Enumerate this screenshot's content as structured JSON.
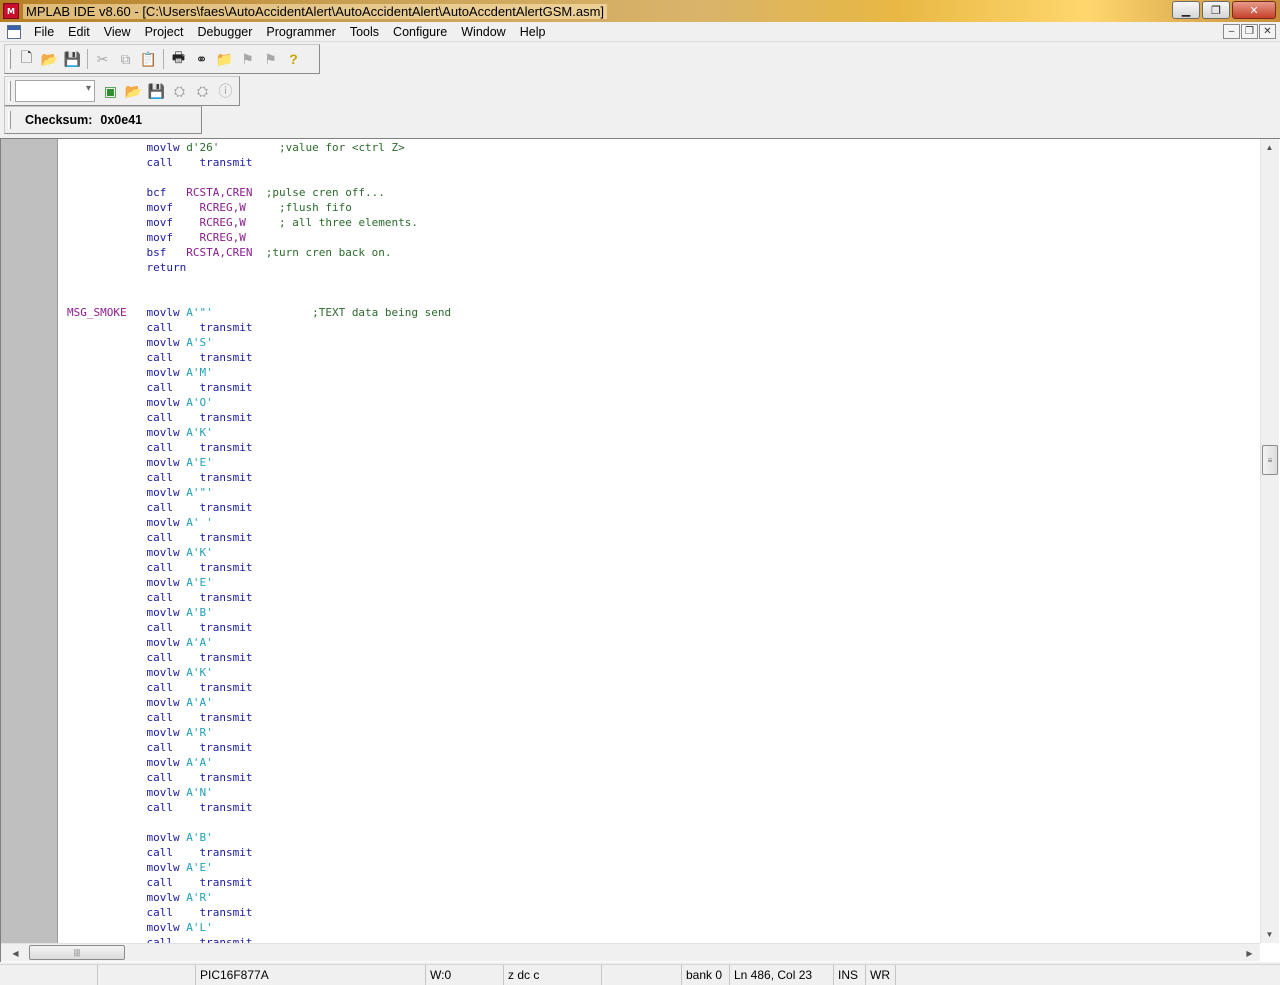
{
  "window": {
    "title": "MPLAB IDE v8.60 - [C:\\Users\\faes\\AutoAccidentAlert\\AutoAccidentAlert\\AutoAccdentAlertGSM.asm]",
    "app_icon_text": "M"
  },
  "menu": [
    "File",
    "Edit",
    "View",
    "Project",
    "Debugger",
    "Programmer",
    "Tools",
    "Configure",
    "Window",
    "Help"
  ],
  "toolbar": {
    "checksum_label": "Checksum:",
    "checksum_value": "0x0e41",
    "combo_value": ""
  },
  "status": {
    "s0": "",
    "device": "PIC16F877A",
    "s2": "",
    "w": "W:0",
    "flags": "z dc c",
    "s5": "",
    "bank": "bank 0",
    "position": "Ln 486, Col 23",
    "ins": "INS",
    "wr": "WR"
  },
  "code_lines": [
    {
      "label": "",
      "op": "movlw",
      "arg": "d'26'",
      "arg_kind": "cm",
      "comment": ";value for <ctrl Z>",
      "pad": "         "
    },
    {
      "label": "",
      "op": "call",
      "arg": "transmit",
      "arg_kind": "txt",
      "comment": "",
      "pad": ""
    },
    {
      "label": "",
      "op": "",
      "arg": "",
      "arg_kind": "txt",
      "comment": "",
      "pad": ""
    },
    {
      "label": "",
      "op": "bcf",
      "arg": "RCSTA,CREN",
      "arg_kind": "lbl",
      "comment": ";pulse cren off...",
      "pad": "  "
    },
    {
      "label": "",
      "op": "movf",
      "arg": "RCREG,W",
      "arg_kind": "lbl",
      "comment": ";flush fifo",
      "pad": "     "
    },
    {
      "label": "",
      "op": "movf",
      "arg": "RCREG,W",
      "arg_kind": "lbl",
      "comment": "; all three elements.",
      "pad": "     "
    },
    {
      "label": "",
      "op": "movf",
      "arg": "RCREG,W",
      "arg_kind": "lbl",
      "comment": "",
      "pad": ""
    },
    {
      "label": "",
      "op": "bsf",
      "arg": "RCSTA,CREN",
      "arg_kind": "lbl",
      "comment": ";turn cren back on.",
      "pad": "  "
    },
    {
      "label": "",
      "op": "return",
      "arg": "",
      "arg_kind": "txt",
      "comment": "",
      "pad": ""
    },
    {
      "label": "",
      "op": "",
      "arg": "",
      "arg_kind": "txt",
      "comment": "",
      "pad": ""
    },
    {
      "label": "",
      "op": "",
      "arg": "",
      "arg_kind": "txt",
      "comment": "",
      "pad": ""
    },
    {
      "label": "MSG_SMOKE",
      "op": "movlw",
      "arg": "A'\"'",
      "arg_kind": "str",
      "comment": ";TEXT data being send",
      "pad": "               "
    },
    {
      "label": "",
      "op": "call",
      "arg": "transmit",
      "arg_kind": "txt",
      "comment": "",
      "pad": ""
    },
    {
      "label": "",
      "op": "movlw",
      "arg": "A'S'",
      "arg_kind": "str",
      "comment": "",
      "pad": ""
    },
    {
      "label": "",
      "op": "call",
      "arg": "transmit",
      "arg_kind": "txt",
      "comment": "",
      "pad": ""
    },
    {
      "label": "",
      "op": "movlw",
      "arg": "A'M'",
      "arg_kind": "str",
      "comment": "",
      "pad": ""
    },
    {
      "label": "",
      "op": "call",
      "arg": "transmit",
      "arg_kind": "txt",
      "comment": "",
      "pad": ""
    },
    {
      "label": "",
      "op": "movlw",
      "arg": "A'O'",
      "arg_kind": "str",
      "comment": "",
      "pad": ""
    },
    {
      "label": "",
      "op": "call",
      "arg": "transmit",
      "arg_kind": "txt",
      "comment": "",
      "pad": ""
    },
    {
      "label": "",
      "op": "movlw",
      "arg": "A'K'",
      "arg_kind": "str",
      "comment": "",
      "pad": ""
    },
    {
      "label": "",
      "op": "call",
      "arg": "transmit",
      "arg_kind": "txt",
      "comment": "",
      "pad": ""
    },
    {
      "label": "",
      "op": "movlw",
      "arg": "A'E'",
      "arg_kind": "str",
      "comment": "",
      "pad": ""
    },
    {
      "label": "",
      "op": "call",
      "arg": "transmit",
      "arg_kind": "txt",
      "comment": "",
      "pad": ""
    },
    {
      "label": "",
      "op": "movlw",
      "arg": "A'\"'",
      "arg_kind": "str",
      "comment": "",
      "pad": ""
    },
    {
      "label": "",
      "op": "call",
      "arg": "transmit",
      "arg_kind": "txt",
      "comment": "",
      "pad": ""
    },
    {
      "label": "",
      "op": "movlw",
      "arg": "A' '",
      "arg_kind": "str",
      "comment": "",
      "pad": ""
    },
    {
      "label": "",
      "op": "call",
      "arg": "transmit",
      "arg_kind": "txt",
      "comment": "",
      "pad": ""
    },
    {
      "label": "",
      "op": "movlw",
      "arg": "A'K'",
      "arg_kind": "str",
      "comment": "",
      "pad": ""
    },
    {
      "label": "",
      "op": "call",
      "arg": "transmit",
      "arg_kind": "txt",
      "comment": "",
      "pad": ""
    },
    {
      "label": "",
      "op": "movlw",
      "arg": "A'E'",
      "arg_kind": "str",
      "comment": "",
      "pad": ""
    },
    {
      "label": "",
      "op": "call",
      "arg": "transmit",
      "arg_kind": "txt",
      "comment": "",
      "pad": ""
    },
    {
      "label": "",
      "op": "movlw",
      "arg": "A'B'",
      "arg_kind": "str",
      "comment": "",
      "pad": ""
    },
    {
      "label": "",
      "op": "call",
      "arg": "transmit",
      "arg_kind": "txt",
      "comment": "",
      "pad": ""
    },
    {
      "label": "",
      "op": "movlw",
      "arg": "A'A'",
      "arg_kind": "str",
      "comment": "",
      "pad": ""
    },
    {
      "label": "",
      "op": "call",
      "arg": "transmit",
      "arg_kind": "txt",
      "comment": "",
      "pad": ""
    },
    {
      "label": "",
      "op": "movlw",
      "arg": "A'K'",
      "arg_kind": "str",
      "comment": "",
      "pad": ""
    },
    {
      "label": "",
      "op": "call",
      "arg": "transmit",
      "arg_kind": "txt",
      "comment": "",
      "pad": ""
    },
    {
      "label": "",
      "op": "movlw",
      "arg": "A'A'",
      "arg_kind": "str",
      "comment": "",
      "pad": ""
    },
    {
      "label": "",
      "op": "call",
      "arg": "transmit",
      "arg_kind": "txt",
      "comment": "",
      "pad": ""
    },
    {
      "label": "",
      "op": "movlw",
      "arg": "A'R'",
      "arg_kind": "str",
      "comment": "",
      "pad": ""
    },
    {
      "label": "",
      "op": "call",
      "arg": "transmit",
      "arg_kind": "txt",
      "comment": "",
      "pad": ""
    },
    {
      "label": "",
      "op": "movlw",
      "arg": "A'A'",
      "arg_kind": "str",
      "comment": "",
      "pad": ""
    },
    {
      "label": "",
      "op": "call",
      "arg": "transmit",
      "arg_kind": "txt",
      "comment": "",
      "pad": ""
    },
    {
      "label": "",
      "op": "movlw",
      "arg": "A'N'",
      "arg_kind": "str",
      "comment": "",
      "pad": ""
    },
    {
      "label": "",
      "op": "call",
      "arg": "transmit",
      "arg_kind": "txt",
      "comment": "",
      "pad": ""
    },
    {
      "label": "",
      "op": "",
      "arg": "",
      "arg_kind": "txt",
      "comment": "",
      "pad": ""
    },
    {
      "label": "",
      "op": "movlw",
      "arg": "A'B'",
      "arg_kind": "str",
      "comment": "",
      "pad": ""
    },
    {
      "label": "",
      "op": "call",
      "arg": "transmit",
      "arg_kind": "txt",
      "comment": "",
      "pad": ""
    },
    {
      "label": "",
      "op": "movlw",
      "arg": "A'E'",
      "arg_kind": "str",
      "comment": "",
      "pad": ""
    },
    {
      "label": "",
      "op": "call",
      "arg": "transmit",
      "arg_kind": "txt",
      "comment": "",
      "pad": ""
    },
    {
      "label": "",
      "op": "movlw",
      "arg": "A'R'",
      "arg_kind": "str",
      "comment": "",
      "pad": ""
    },
    {
      "label": "",
      "op": "call",
      "arg": "transmit",
      "arg_kind": "txt",
      "comment": "",
      "pad": ""
    },
    {
      "label": "",
      "op": "movlw",
      "arg": "A'L'",
      "arg_kind": "str",
      "comment": "",
      "pad": ""
    },
    {
      "label": "",
      "op": "call",
      "arg": "transmit",
      "arg_kind": "txt",
      "comment": "",
      "pad": ""
    }
  ]
}
